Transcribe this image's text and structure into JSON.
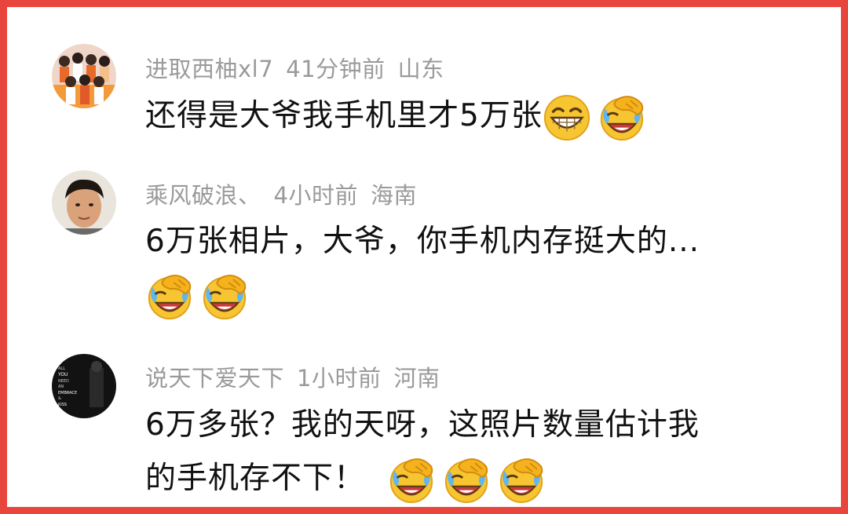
{
  "comments": [
    {
      "username": "进取西柚xl7",
      "time": "41分钟前",
      "location": "山东",
      "text": "还得是大爷我手机里才5万张",
      "emojis": [
        "grinning-squint-icon",
        "laughing-tears-icon"
      ]
    },
    {
      "username": "乘风破浪、",
      "time": "4小时前",
      "location": "海南",
      "text": "6万张相片，大爷，你手机内存挺大的...",
      "emojis": [
        "laughing-tears-icon",
        "laughing-tears-icon"
      ]
    },
    {
      "username": "说天下爱天下",
      "time": "1小时前",
      "location": "河南",
      "text_line1": "6万多张？我的天呀，这照片数量估计我",
      "text_line2": "的手机存不下！",
      "emojis": [
        "laughing-tears-icon",
        "laughing-tears-icon",
        "laughing-tears-icon"
      ]
    }
  ],
  "avatar3_text": [
    "ALL",
    "YOU",
    "NEED",
    "AN",
    "EMBRACE",
    "&",
    "KISS"
  ],
  "colors": {
    "border": "#e8463c",
    "meta_text": "#9a9a9a",
    "body_text": "#111111",
    "emoji_face": "#f7c531"
  }
}
